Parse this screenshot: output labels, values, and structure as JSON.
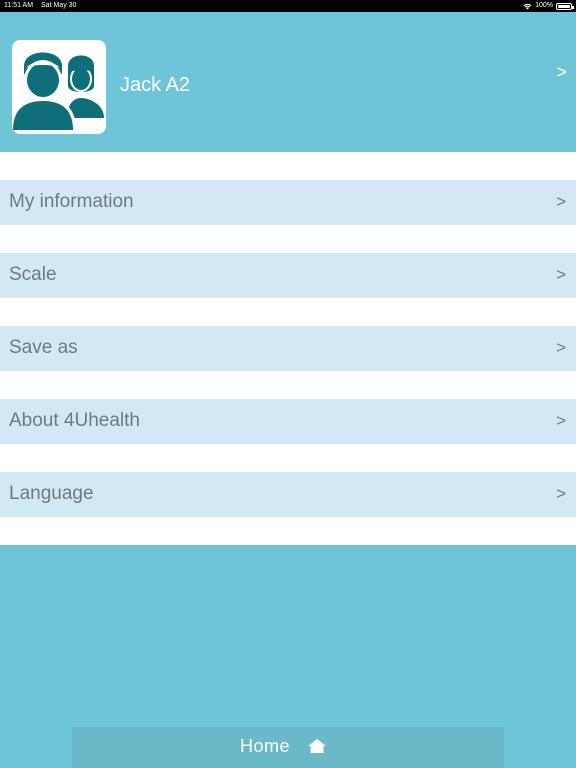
{
  "status_bar": {
    "time": "11:51 AM",
    "date": "Sat May 30",
    "battery": "100%"
  },
  "profile": {
    "name": "Jack A2",
    "chevron": ">",
    "avatar_icon": "family-icon"
  },
  "menu": {
    "items": [
      {
        "label": "My information",
        "chevron": ">"
      },
      {
        "label": "Scale",
        "chevron": ">"
      },
      {
        "label": "Save as",
        "chevron": ">"
      },
      {
        "label": "About 4Uhealth",
        "chevron": ">"
      },
      {
        "label": "Language",
        "chevron": ">"
      }
    ]
  },
  "footer": {
    "home_label": "Home",
    "home_icon": "home-icon"
  },
  "colors": {
    "background": "#6dc5d7",
    "menu_item": "#d2e9f5",
    "menu_text": "#6e7a80",
    "avatar_fill": "#0e6e7a",
    "footer_bar": "#6ab9c9"
  }
}
